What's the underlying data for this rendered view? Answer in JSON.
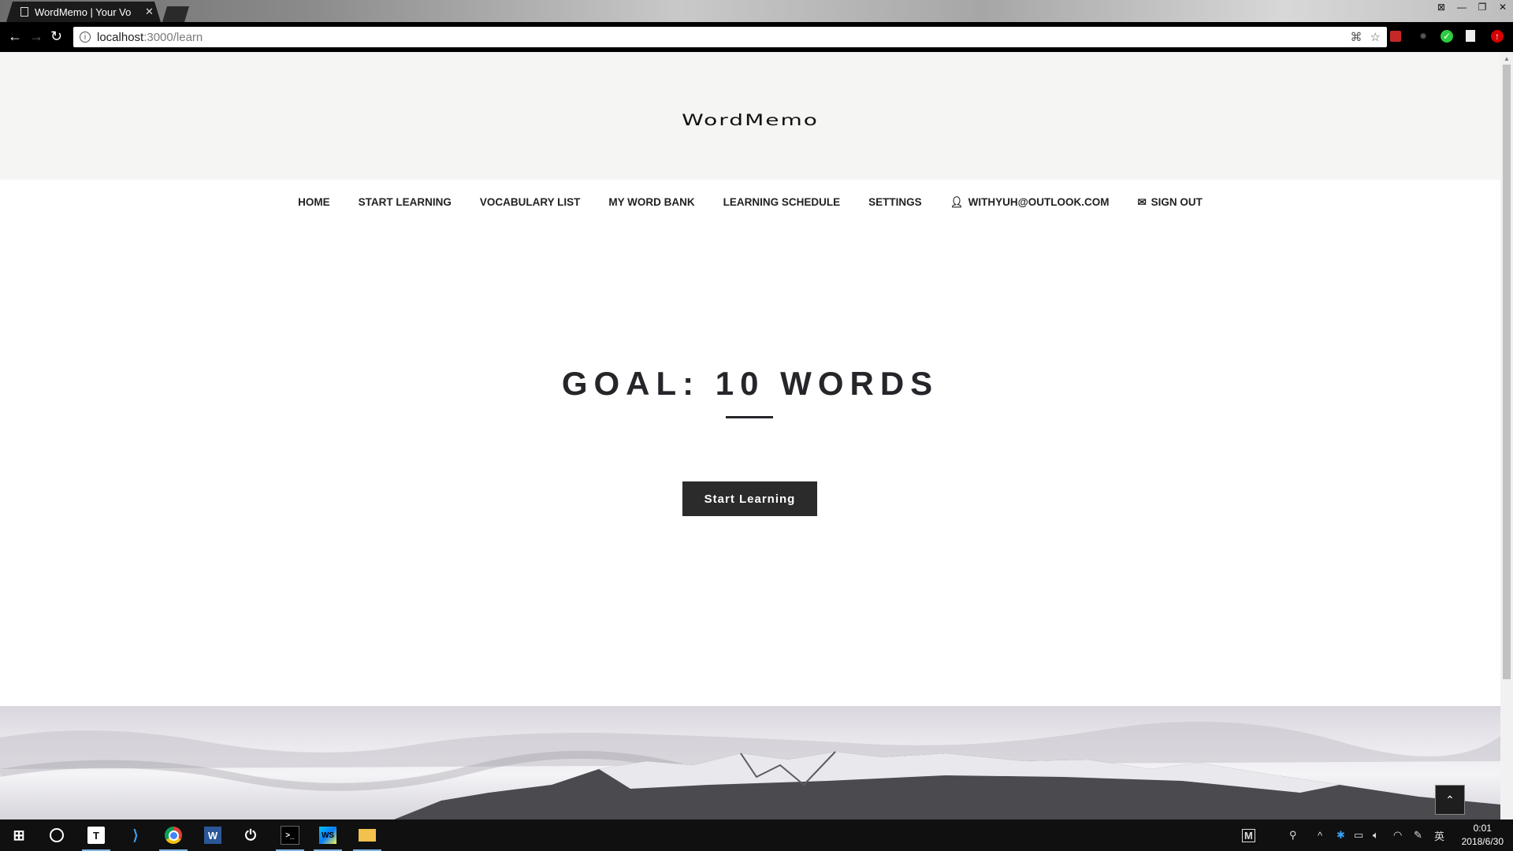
{
  "browser": {
    "tab_title": "WordMemo | Your Vo",
    "tab_close": "✕",
    "url_host": "localhost",
    "url_path": ":3000/learn"
  },
  "site": {
    "logo": "WordMemo",
    "nav": [
      {
        "label": "HOME"
      },
      {
        "label": "START LEARNING"
      },
      {
        "label": "VOCABULARY LIST"
      },
      {
        "label": "MY WORD BANK"
      },
      {
        "label": "LEARNING SCHEDULE"
      },
      {
        "label": "SETTINGS"
      },
      {
        "label": "WITHYUH@OUTLOOK.COM",
        "icon": "user-icon"
      },
      {
        "label": "SIGN OUT",
        "icon": "comments-icon"
      }
    ]
  },
  "main": {
    "goal_heading": "GOAL: 10 WORDS",
    "start_button": "Start Learning"
  },
  "taskbar": {
    "time": "0:01",
    "date": "2018/6/30",
    "ime": "英"
  },
  "colors": {
    "header_bg": "#f5f5f4",
    "button_bg": "#2b2b2b",
    "heading": "#25252a"
  }
}
